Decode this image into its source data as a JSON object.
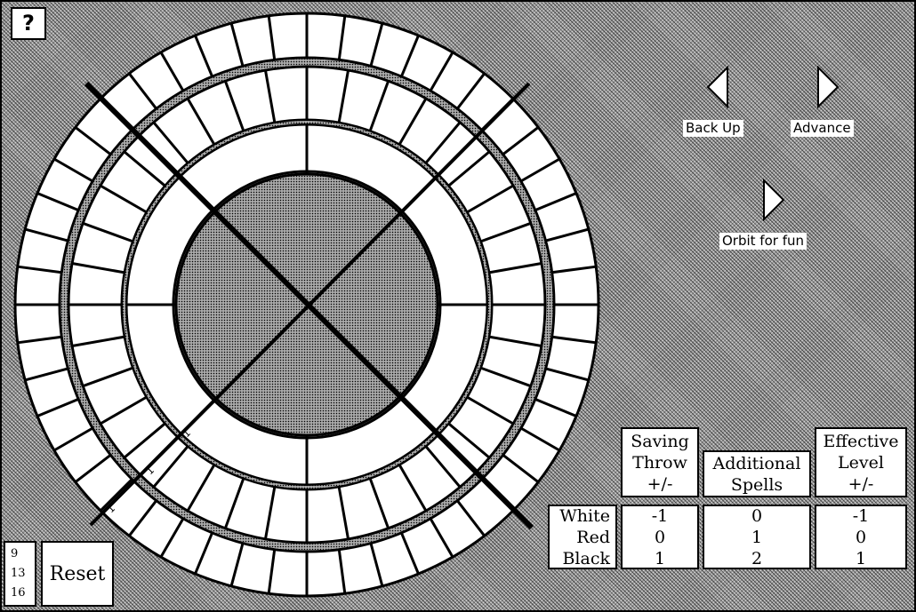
{
  "help_button": {
    "label": "?"
  },
  "nav": {
    "back_up": "Back Up",
    "advance": "Advance",
    "orbit": "Orbit for fun"
  },
  "board": {
    "outer_ring_segments": 48,
    "middle_ring_segments": 36,
    "inner_ring_segments": 4,
    "tick_labels": [
      "1",
      "1",
      "1"
    ]
  },
  "table": {
    "headers": {
      "saving_throw": "Saving\nThrow\n+/-",
      "additional_spells": "Additional\nSpells",
      "effective_level": "Effective\nLevel\n+/-"
    },
    "rows": [
      {
        "moon": "White",
        "saving_throw": "-1",
        "additional_spells": "0",
        "effective_level": "-1"
      },
      {
        "moon": "Red",
        "saving_throw": "0",
        "additional_spells": "1",
        "effective_level": "0"
      },
      {
        "moon": "Black",
        "saving_throw": "1",
        "additional_spells": "2",
        "effective_level": "1"
      }
    ]
  },
  "counters": [
    "9",
    "13",
    "16"
  ],
  "reset_button": {
    "label": "Reset"
  },
  "colors": {
    "ink": "#000000",
    "paper": "#ffffff",
    "dither": "#9a9a9a"
  }
}
